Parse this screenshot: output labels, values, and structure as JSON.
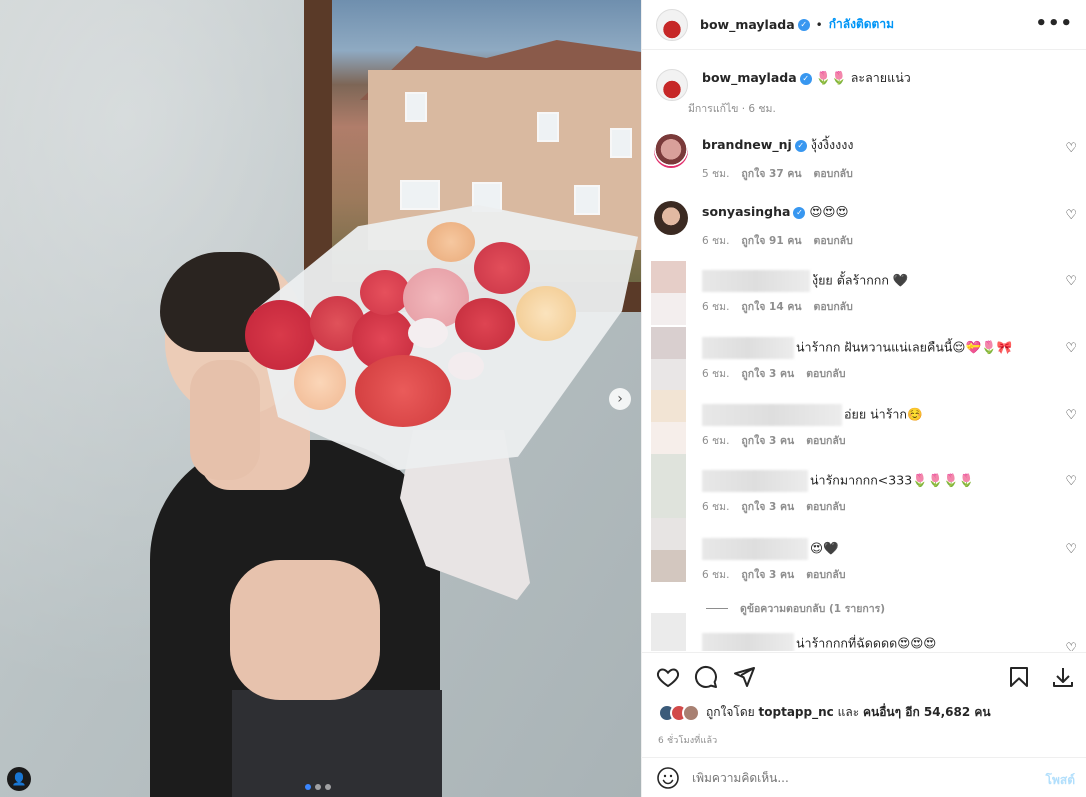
{
  "post": {
    "username": "bow_maylada",
    "follow_separator": "•",
    "follow_label": "กำลังติดตาม",
    "more_icon": "•••",
    "caption_text": "🌷🌷 ละลายแน่ว",
    "caption_meta": "มีการแก้ไข · 6 ชม.",
    "carousel_next": "›",
    "tag_icon": "👤"
  },
  "comments": [
    {
      "user": "brandnew_nj",
      "text": "งุ้งงิ้งงงง",
      "time": "5 ชม.",
      "likes": "ถูกใจ 37 คน",
      "reply": "ตอบกลับ",
      "verified": true
    },
    {
      "user": "sonyasingha",
      "text": "😍😍😍",
      "time": "6 ชม.",
      "likes": "ถูกใจ 91 คน",
      "reply": "ตอบกลับ",
      "verified": true
    },
    {
      "user": "",
      "text": "งุ้ยย ตั้ลร้ากกก 🖤",
      "time": "6 ชม.",
      "likes": "ถูกใจ 14 คน",
      "reply": "ตอบกลับ"
    },
    {
      "user": "",
      "text": "น่าร้ากก ฝันหวานแน่เลยคืนนี้😌💝🌷🎀",
      "time": "6 ชม.",
      "likes": "ถูกใจ 3 คน",
      "reply": "ตอบกลับ"
    },
    {
      "user": "",
      "text": "อ่ยย น่าร้าก☺️",
      "time": "6 ชม.",
      "likes": "ถูกใจ 3 คน",
      "reply": "ตอบกลับ"
    },
    {
      "user": "",
      "text": "น่ารักมากกก<333🌷🌷🌷🌷",
      "time": "6 ชม.",
      "likes": "ถูกใจ 3 คน",
      "reply": "ตอบกลับ"
    },
    {
      "user": "",
      "text": "😍🖤",
      "time": "6 ชม.",
      "likes": "ถูกใจ 3 คน",
      "reply": "ตอบกลับ"
    },
    {
      "user": "",
      "text": "น่าร้ากกกที่ฉัดดดด😍😍😍",
      "time": "",
      "likes": "",
      "reply": ""
    }
  ],
  "view_replies": "ดูข้อความตอบกลับ (1 รายการ)",
  "likes": {
    "prefix": "ถูกใจโดย",
    "first_user": "toptapp_nc",
    "middle": "และ",
    "others": "คนอื่นๆ อีก 54,682 คน"
  },
  "timestamp": "6 ชั่วโมงที่แล้ว",
  "add_comment": {
    "placeholder": "เพิ่มความคิดเห็น...",
    "post_label": "โพสต์"
  },
  "colors": {
    "link_blue": "#0095f6",
    "verified_blue": "#3897f0",
    "muted": "#8e8e8e",
    "post_disabled": "#b2dffc"
  }
}
